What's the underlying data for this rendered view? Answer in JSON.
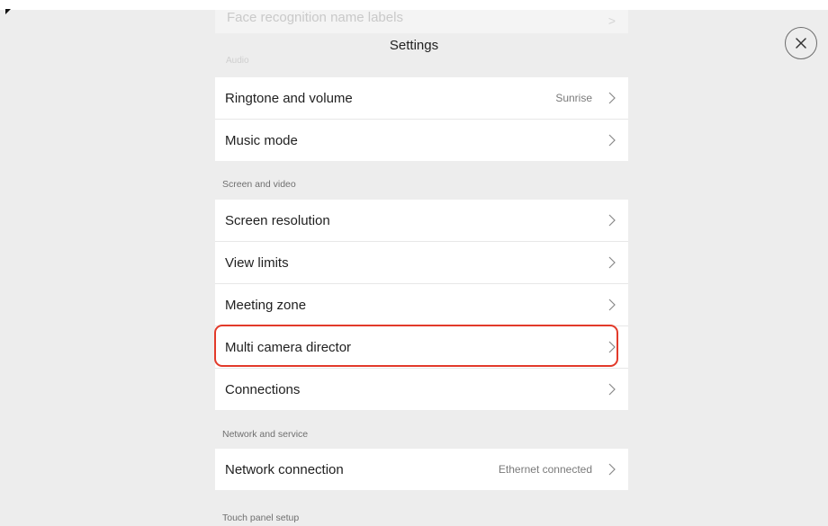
{
  "header": {
    "title": "Settings",
    "close_icon": "close-icon"
  },
  "faded_top": {
    "item_label": "Face recognition name labels",
    "section_label": "Audio"
  },
  "audio": {
    "items": [
      {
        "label": "Ringtone and volume",
        "value": "Sunrise"
      },
      {
        "label": "Music mode",
        "value": ""
      }
    ]
  },
  "screen_video": {
    "section_label": "Screen and video",
    "items": [
      {
        "label": "Screen resolution"
      },
      {
        "label": "View limits"
      },
      {
        "label": "Meeting zone"
      },
      {
        "label": "Multi camera director"
      },
      {
        "label": "Connections"
      }
    ]
  },
  "network": {
    "section_label": "Network and service",
    "items": [
      {
        "label": "Network connection",
        "value": "Ethernet connected"
      }
    ]
  },
  "touch_panel": {
    "section_label": "Touch panel setup"
  },
  "annotation": {
    "highlight_color": "#e23a2a"
  }
}
